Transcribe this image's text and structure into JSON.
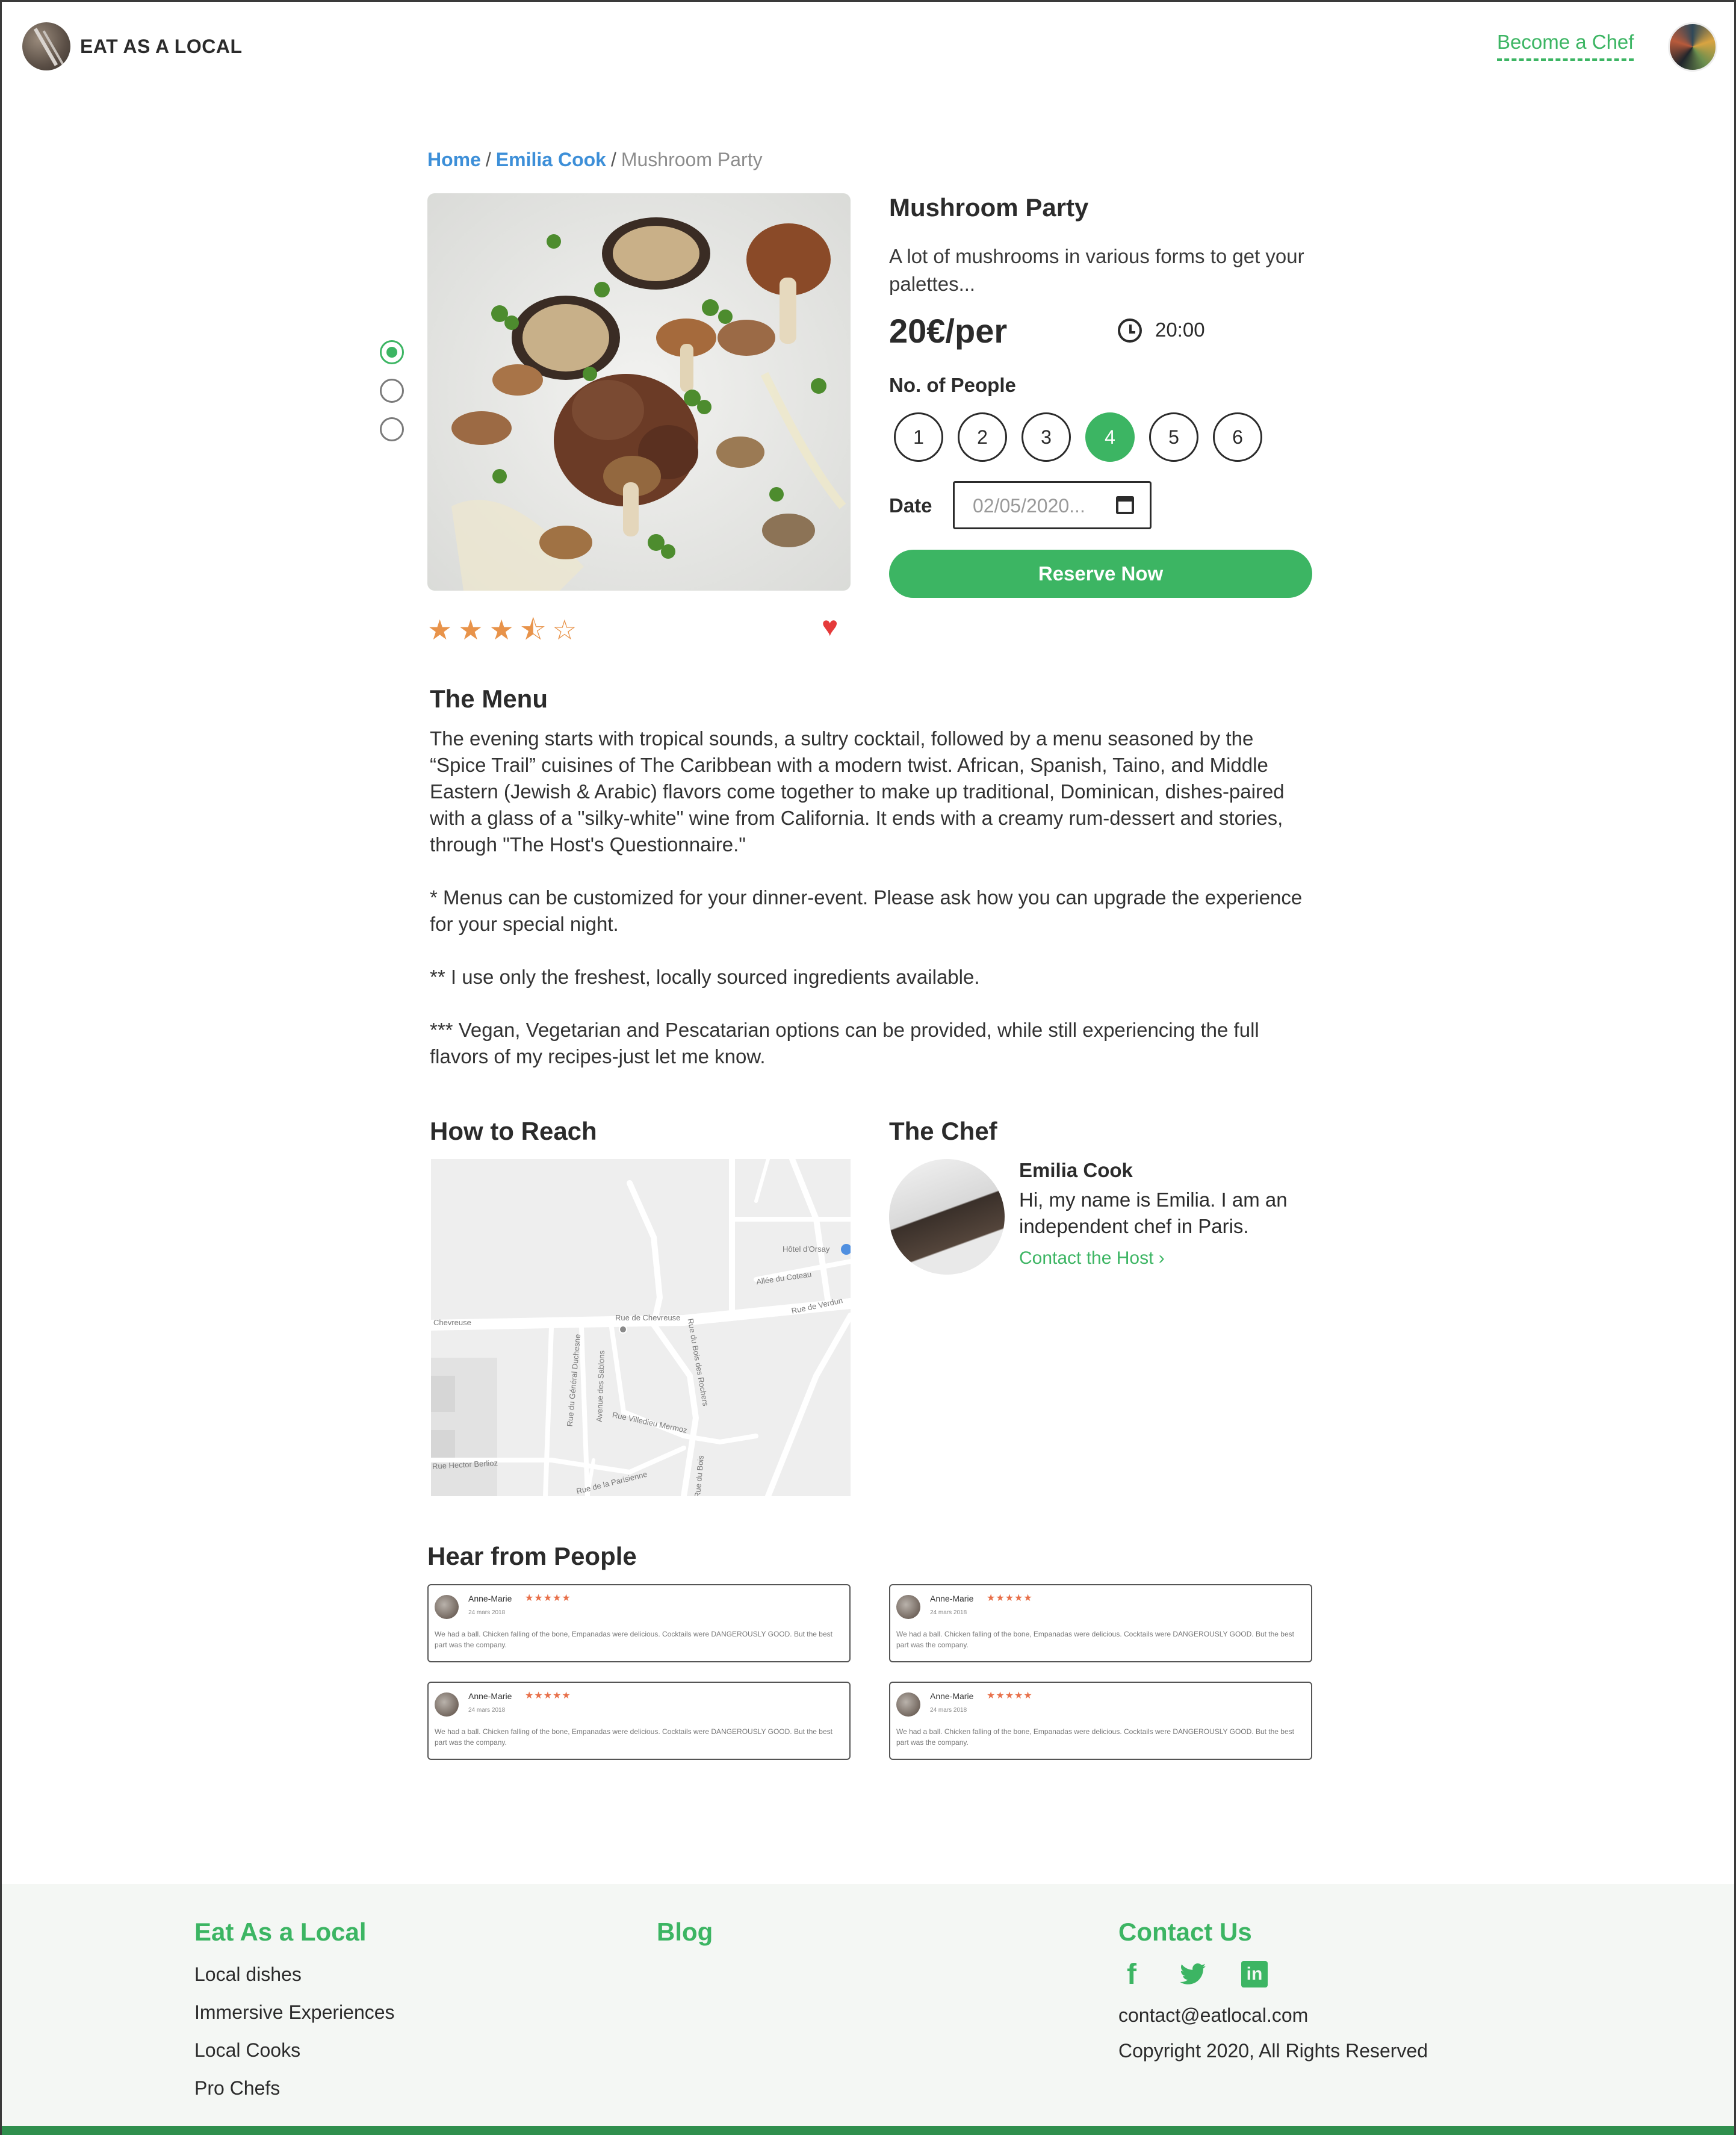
{
  "header": {
    "brand": "EAT AS A LOCAL",
    "become_chef": "Become a Chef"
  },
  "breadcrumb": {
    "home": "Home",
    "chef": "Emilia Cook",
    "current": "Mushroom Party",
    "separator": "/"
  },
  "product": {
    "title": "Mushroom Party",
    "description": "A lot of mushrooms in various forms to get your palettes...",
    "price": "20€/per",
    "time": "20:00",
    "people_label": "No. of People",
    "people_options": [
      "1",
      "2",
      "3",
      "4",
      "5",
      "6"
    ],
    "people_selected": "4",
    "date_label": "Date",
    "date_value": "02/05/2020...",
    "reserve_label": "Reserve Now",
    "rating": 3.5,
    "rating_max": 5,
    "rating_stars": "★★★⯪☆",
    "favorite_icon": "heart-icon",
    "slides_total": 3,
    "slide_active": 1
  },
  "menu": {
    "title": "The Menu",
    "paragraphs": [
      "The evening starts with tropical sounds, a sultry cocktail, followed by a menu seasoned by the “Spice Trail” cuisines of The Caribbean with a modern twist. African, Spanish, Taino, and Middle Eastern (Jewish & Arabic) flavors come together to make up traditional, Dominican, dishes-paired with a glass of a \"silky-white\" wine from California. It ends with a creamy rum-dessert and stories, through \"The Host's Questionnaire.\"",
      "* Menus can be customized for your dinner-event. Please ask how you can upgrade the experience for your special night.",
      "** I use only the freshest, locally sourced ingredients available.",
      "*** Vegan, Vegetarian and Pescatarian options can be provided, while still experiencing the full flavors of my recipes-just let me know."
    ]
  },
  "reach": {
    "title": "How to Reach",
    "map_labels": [
      "Hôtel d'Orsay",
      "Allée du Coteau",
      "Rue de Verdun",
      "Rue de Chevreuse",
      "Chevreuse",
      "Rue du Général Duchesne",
      "Avenue des Sablons",
      "Rue du Bois des Rochers",
      "Rue Villedieu Mermoz",
      "Rue Hector Berlioz",
      "Rue de la Parisienne",
      "Rue du Bois"
    ]
  },
  "chef": {
    "title": "The Chef",
    "name": "Emilia Cook",
    "bio": "Hi, my name is Emilia. I am an independent chef in Paris.",
    "contact": "Contact the Host"
  },
  "reviews": {
    "title": "Hear from People",
    "items": [
      {
        "name": "Anne-Marie",
        "stars": "★★★★★",
        "date": "24 mars 2018",
        "text": "We had a ball. Chicken falling of the bone, Empanadas were delicious. Cocktails were DANGEROUSLY GOOD. But the best part was the company."
      },
      {
        "name": "Anne-Marie",
        "stars": "★★★★★",
        "date": "24 mars 2018",
        "text": "We had a ball. Chicken falling of the bone, Empanadas were delicious. Cocktails were DANGEROUSLY GOOD. But the best part was the company."
      },
      {
        "name": "Anne-Marie",
        "stars": "★★★★★",
        "date": "24 mars 2018",
        "text": "We had a ball. Chicken falling of the bone, Empanadas were delicious. Cocktails were DANGEROUSLY GOOD. But the best part was the company."
      },
      {
        "name": "Anne-Marie",
        "stars": "★★★★★",
        "date": "24 mars 2018",
        "text": "We had a ball. Chicken falling of the bone, Empanadas were delicious. Cocktails were DANGEROUSLY GOOD. But the best part was the company."
      }
    ]
  },
  "footer": {
    "col1_title": "Eat As a Local",
    "col1_links": [
      "Local dishes",
      "Immersive Experiences",
      "Local Cooks",
      "Pro Chefs"
    ],
    "col2_title": "Blog",
    "col3_title": "Contact Us",
    "social": [
      "facebook-icon",
      "twitter-icon",
      "linkedin-icon"
    ],
    "email": "contact@eatlocal.com",
    "copyright": "Copyright 2020, All Rights Reserved"
  },
  "colors": {
    "accent": "#3cb563",
    "link_blue": "#3d8fd8",
    "star": "#e8934a",
    "heart": "#e53a3a",
    "footer_bg": "#f4f7f4",
    "footer_bar": "#2f8f4d"
  }
}
